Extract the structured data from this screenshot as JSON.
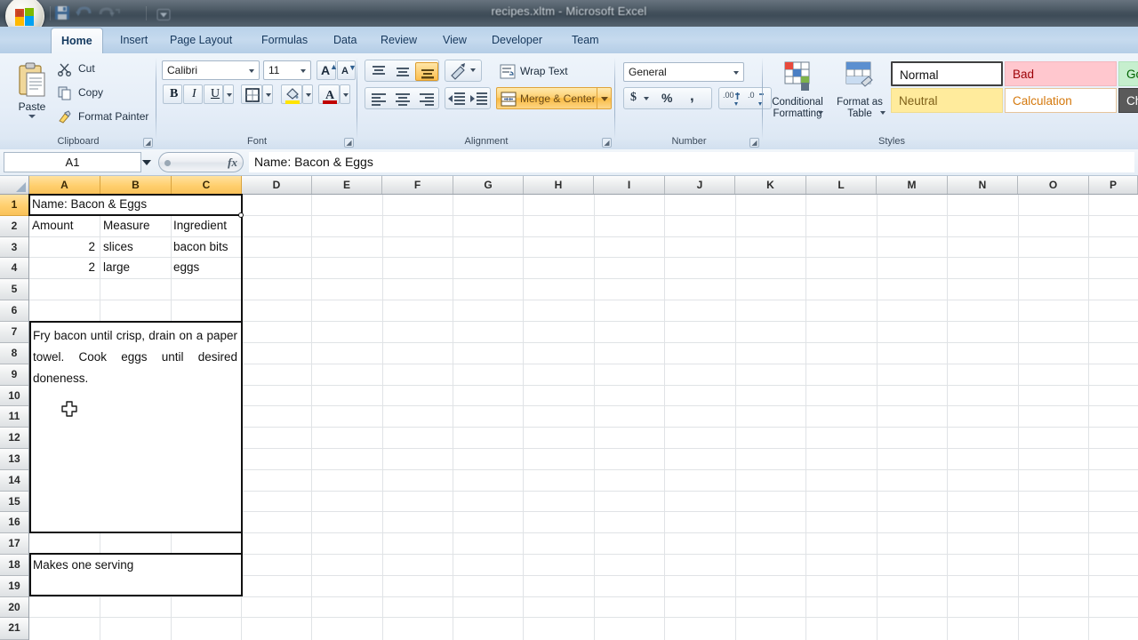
{
  "window": {
    "title": "recipes.xltm - Microsoft Excel",
    "orb_name": "office-button",
    "quick_access": [
      {
        "name": "save-icon",
        "label": "Save"
      },
      {
        "name": "undo-icon",
        "label": "Undo"
      },
      {
        "name": "redo-icon",
        "label": "Redo"
      },
      {
        "name": "customize-quick-access-icon",
        "label": "Customize Quick Access Toolbar"
      }
    ]
  },
  "ribbon": {
    "tabs": [
      {
        "label": "Home",
        "active": true
      },
      {
        "label": "Insert",
        "active": false
      },
      {
        "label": "Page Layout",
        "active": false
      },
      {
        "label": "Formulas",
        "active": false
      },
      {
        "label": "Data",
        "active": false
      },
      {
        "label": "Review",
        "active": false
      },
      {
        "label": "View",
        "active": false
      },
      {
        "label": "Developer",
        "active": false
      },
      {
        "label": "Team",
        "active": false
      }
    ],
    "clipboard": {
      "group_label": "Clipboard",
      "paste": "Paste",
      "cut": "Cut",
      "copy": "Copy",
      "format_painter": "Format Painter"
    },
    "font": {
      "group_label": "Font",
      "font_name": "Calibri",
      "font_size": "11",
      "grow": "A",
      "shrink": "A",
      "bold": "B",
      "italic": "I",
      "underline": "U",
      "fill_color": "#ffe400",
      "font_color": "#c00000"
    },
    "alignment": {
      "group_label": "Alignment",
      "wrap_text": "Wrap Text",
      "merge_center": "Merge & Center",
      "merge_center_state": "highlighted",
      "vertical_selected": "bottom-align",
      "highlight_color": "#f9bb43"
    },
    "number": {
      "group_label": "Number",
      "format": "General",
      "currency": "$",
      "percent": "%",
      "comma": ",",
      "increase_decimal": "Increase Decimal",
      "decrease_decimal": "Decrease Decimal"
    },
    "styles": {
      "group_label": "Styles",
      "conditional_formatting": "Conditional Formatting",
      "format_as_table": "Format as Table",
      "cell_styles": [
        {
          "label": "Normal",
          "bg": "#ffffff",
          "fg": "#111111",
          "selected": true
        },
        {
          "label": "Bad",
          "bg": "#ffc7ce",
          "fg": "#9c0006",
          "selected": false
        },
        {
          "label": "Good",
          "bg": "#c6efce",
          "fg": "#006100",
          "selected": false
        },
        {
          "label": "Neutral",
          "bg": "#ffeb9c",
          "fg": "#7d5f18",
          "selected": false
        },
        {
          "label": "Calculation",
          "bg": "#ffffff",
          "fg": "#d4780c",
          "selected": false
        },
        {
          "label": "Check Cell",
          "bg": "#5a5a5a",
          "fg": "#ffffff",
          "selected": false
        }
      ]
    }
  },
  "formula_bar": {
    "name_box": "A1",
    "fx_label": "fx",
    "formula": "Name: Bacon & Eggs"
  },
  "grid": {
    "columns": [
      "A",
      "B",
      "C",
      "D",
      "E",
      "F",
      "G",
      "H",
      "I",
      "J",
      "K",
      "L",
      "M",
      "N",
      "O",
      "P"
    ],
    "selected_columns": [
      "A",
      "B",
      "C"
    ],
    "rows": [
      "1",
      "2",
      "3",
      "4",
      "5",
      "6",
      "7",
      "8",
      "9",
      "10",
      "11",
      "12",
      "13",
      "14",
      "15",
      "16",
      "17",
      "18",
      "19",
      "20",
      "21"
    ],
    "selected_rows": [
      "1"
    ],
    "active_cell": "A1",
    "cells": {
      "A1": "Name: Bacon & Eggs",
      "A2": "Amount",
      "B2": "Measure",
      "C2": "Ingredient",
      "A3": "2",
      "B3": "slices",
      "C3": "bacon bits",
      "A4": "2",
      "B4": "large",
      "C4": "eggs",
      "A7": "Fry bacon until crisp, drain on a paper towel. Cook eggs until desired doneness.",
      "A18": "Makes one serving"
    },
    "merged_ranges": [
      "A1:C1",
      "A7:C17",
      "A18:C19"
    ]
  }
}
